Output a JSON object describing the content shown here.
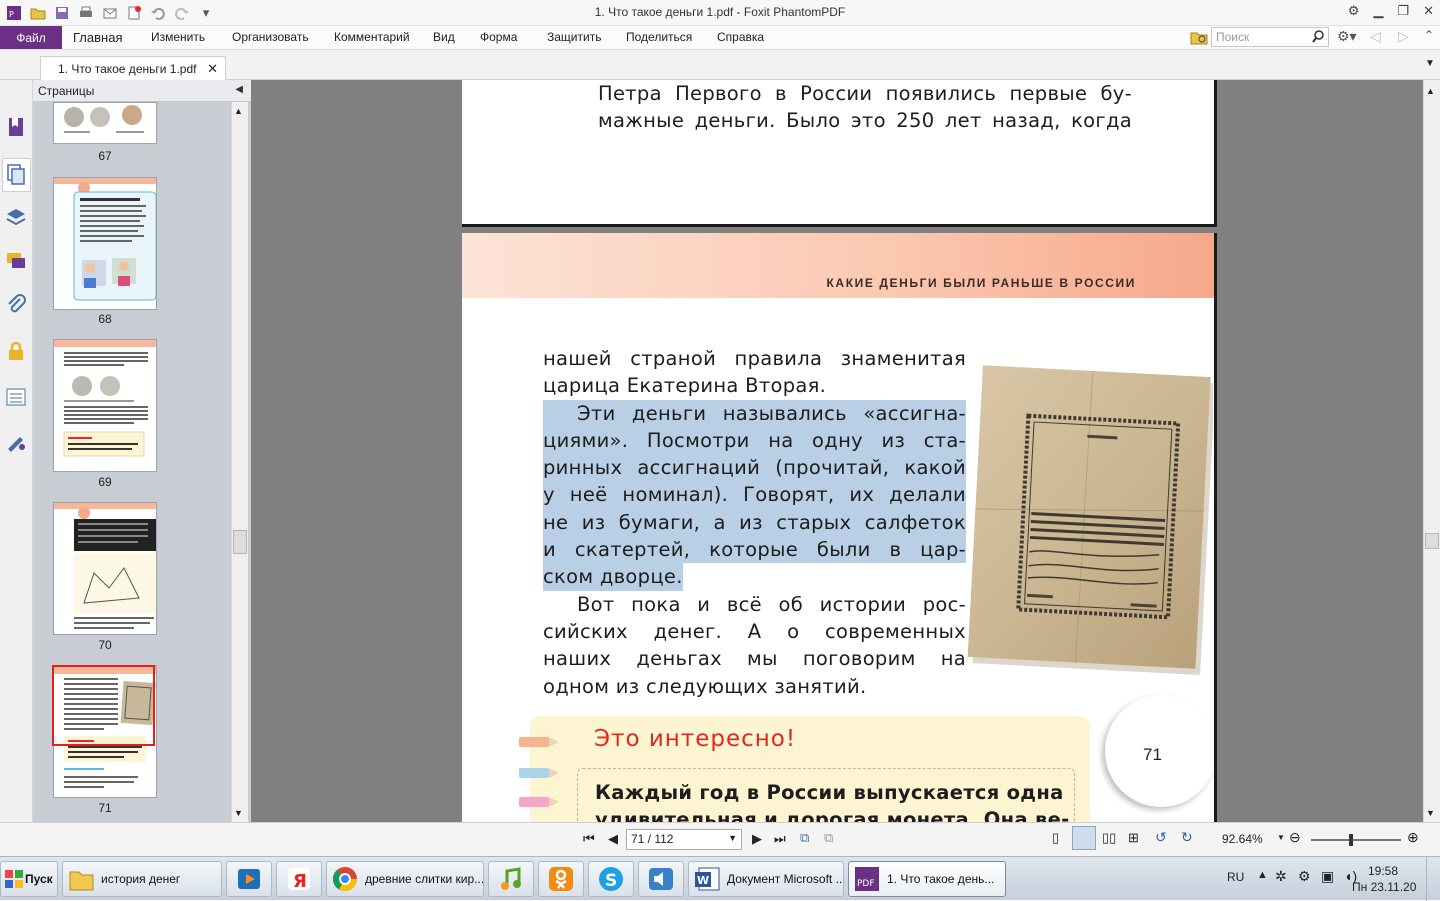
{
  "window": {
    "title": "1. Что такое деньги 1.pdf - Foxit PhantomPDF"
  },
  "menu": {
    "file": "Файл",
    "items": [
      "Главная",
      "Изменить",
      "Организовать",
      "Комментарий",
      "Вид",
      "Форма",
      "Защитить",
      "Поделиться",
      "Справка"
    ],
    "search_placeholder": "Поиск"
  },
  "tab": {
    "label": "1. Что такое деньги 1.pdf"
  },
  "sidebar": {
    "title": "Страницы",
    "thumbnails": [
      {
        "num": "67"
      },
      {
        "num": "68"
      },
      {
        "num": "69"
      },
      {
        "num": "70"
      },
      {
        "num": "71",
        "selected": true
      }
    ]
  },
  "document": {
    "prev_page_lines": [
      "Петра Первого в России появились первые бу-",
      "мажные деньги. Было это 250 лет назад, когда"
    ],
    "header": "КАКИЕ ДЕНЬГИ БЫЛИ РАНЬШЕ В РОССИИ",
    "lines": [
      {
        "text": "нашей страной правила знаменитая",
        "hl": false,
        "indent": false
      },
      {
        "text": "царица Екатерина Вторая.",
        "hl": false,
        "indent": false,
        "last": true
      },
      {
        "text": "Эти деньги назывались «ассигна-",
        "hl": true,
        "indent": true
      },
      {
        "text": "циями». Посмотри на одну из ста-",
        "hl": true,
        "indent": false
      },
      {
        "text": "ринных ассигнаций (прочитай, какой",
        "hl": true,
        "indent": false
      },
      {
        "text": "у неё номинал). Говорят, их делали",
        "hl": true,
        "indent": false
      },
      {
        "text": "не из бумаги, а из старых салфеток",
        "hl": true,
        "indent": false
      },
      {
        "text": "и скатертей, которые были в цар-",
        "hl": true,
        "indent": false
      },
      {
        "text": "ском дворце.",
        "hl": true,
        "indent": false,
        "last": true
      },
      {
        "text": "Вот пока и всё об истории рос-",
        "hl": false,
        "indent": true
      },
      {
        "text": "сийских денег. А о современных",
        "hl": false,
        "indent": false
      },
      {
        "text": "наших деньгах мы поговорим на",
        "hl": false,
        "indent": false
      },
      {
        "text": "одном из следующих занятий.",
        "hl": false,
        "indent": false,
        "last": true
      }
    ],
    "page_number": "71",
    "interesting_title": "Это интересно!",
    "interesting_lines": [
      "Каждый год в России выпускается одна",
      "удивительная и дорогая монета. Она ве-"
    ]
  },
  "navbar": {
    "page_field": "71 / 112",
    "zoom": "92.64%"
  },
  "taskbar": {
    "start": "Пуск",
    "items": [
      {
        "label": "история денег",
        "icon": "folder-icon"
      },
      {
        "label": "древние слитки кир...",
        "icon": "chrome-icon"
      },
      {
        "label": "Документ Microsoft ...",
        "icon": "word-icon"
      },
      {
        "label": "1. Что такое день...",
        "icon": "pdf-icon"
      }
    ],
    "lang": "RU",
    "time": "19:58",
    "date": "Пн 23.11.20"
  },
  "colors": {
    "file_tab": "#6b2f86",
    "header_band": "#f6a88a",
    "highlight": "#b8cfe6",
    "selected_thumb": "#e0201a"
  }
}
